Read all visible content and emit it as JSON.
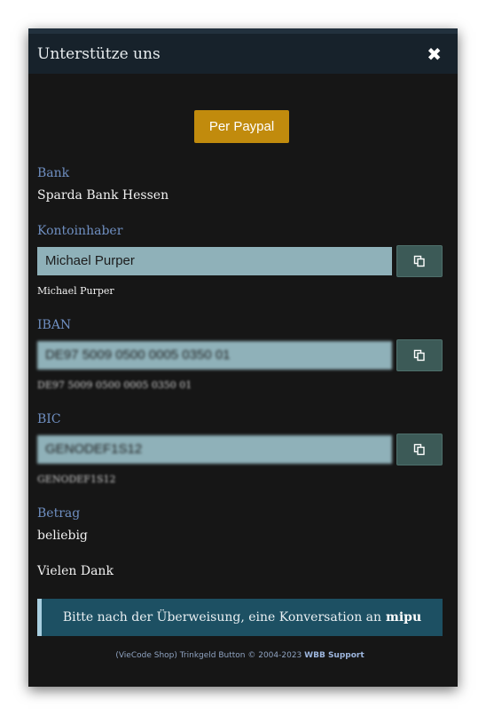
{
  "dialog": {
    "title": "Unterstütze uns",
    "close_icon": "close-icon"
  },
  "paypal": {
    "label": "Per Paypal",
    "color": "#c18b0d"
  },
  "bank": {
    "label": "Bank",
    "value": "Sparda Bank Hessen"
  },
  "owner": {
    "label": "Kontoinhaber",
    "field_value": "Michael Purper",
    "caption": "Michael Purper",
    "copy_icon": "copy-icon"
  },
  "iban": {
    "label": "IBAN",
    "field_value": "DE97 5009 0500 0005 0350 01",
    "caption": "DE97 5009 0500 0005 0350 01",
    "copy_icon": "copy-icon"
  },
  "bic": {
    "label": "BIC",
    "field_value": "GENODEF1S12",
    "caption": "GENODEF1S12",
    "copy_icon": "copy-icon"
  },
  "amount": {
    "label": "Betrag",
    "value": "beliebig"
  },
  "thanks": "Vielen Dank",
  "notice": {
    "text": "Bitte nach der Überweisung, eine Konversation an",
    "user": "mipu"
  },
  "footer": {
    "text": "(VieCode Shop) Trinkgeld Button © 2004-2023",
    "link": "WBB Support"
  }
}
